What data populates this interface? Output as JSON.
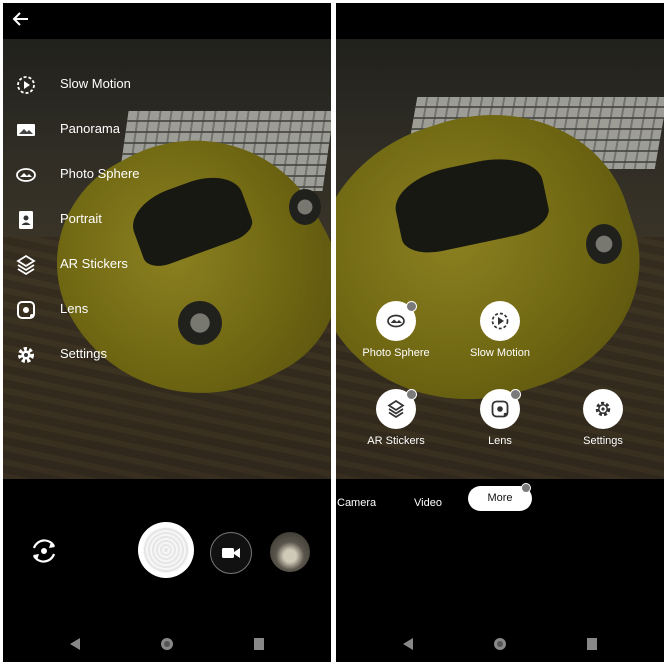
{
  "left_screen": {
    "menu": [
      {
        "label": "Slow Motion",
        "icon": "slow-motion-icon"
      },
      {
        "label": "Panorama",
        "icon": "panorama-icon"
      },
      {
        "label": "Photo Sphere",
        "icon": "photo-sphere-icon"
      },
      {
        "label": "Portrait",
        "icon": "portrait-icon"
      },
      {
        "label": "AR Stickers",
        "icon": "ar-stickers-icon"
      },
      {
        "label": "Lens",
        "icon": "lens-icon"
      },
      {
        "label": "Settings",
        "icon": "settings-icon"
      }
    ]
  },
  "right_screen": {
    "modes": [
      {
        "label": "Photo Sphere",
        "icon": "photo-sphere-icon"
      },
      {
        "label": "Slow Motion",
        "icon": "slow-motion-icon"
      },
      {
        "label": "AR Stickers",
        "icon": "ar-stickers-icon"
      },
      {
        "label": "Lens",
        "icon": "lens-icon"
      },
      {
        "label": "Settings",
        "icon": "settings-icon"
      }
    ],
    "tabs": {
      "camera": "Camera",
      "video": "Video",
      "more": "More"
    }
  },
  "colors": {
    "background": "#000000",
    "pill": "#ffffff",
    "car": "#a89b22"
  }
}
